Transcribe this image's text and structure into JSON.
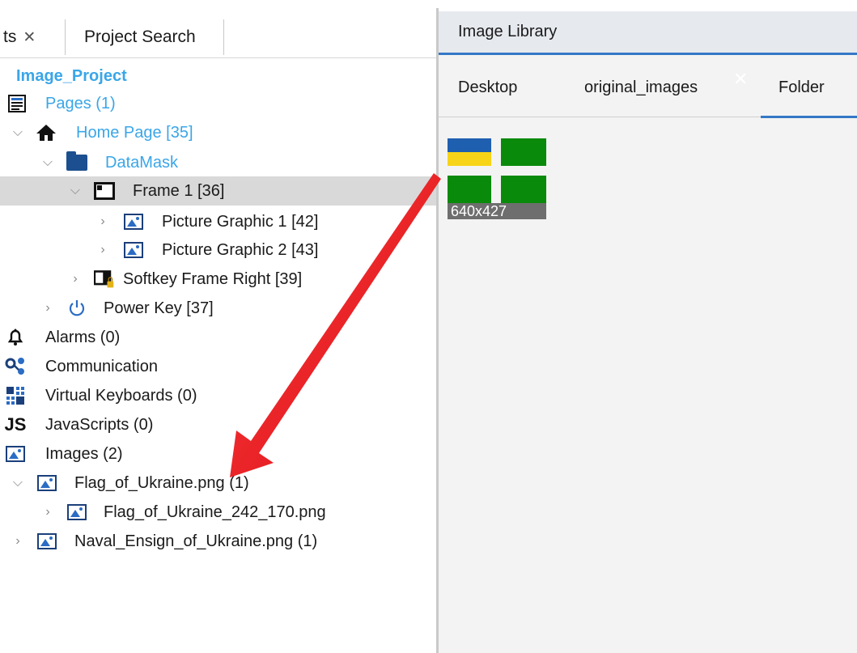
{
  "left_tabs": {
    "projects_label": "ts",
    "projects_close": "✕",
    "search_label": "Project Search"
  },
  "tree": {
    "project": "Image_Project",
    "pages": "Pages (1)",
    "home_page": "Home Page [35]",
    "datamask": "DataMask",
    "frame1": "Frame 1 [36]",
    "picture1": "Picture Graphic 1 [42]",
    "picture2": "Picture Graphic 2 [43]",
    "softkey": "Softkey Frame Right [39]",
    "power_key": "Power Key [37]",
    "alarms": "Alarms (0)",
    "communication": "Communication",
    "virtual_keyboards": "Virtual Keyboards (0)",
    "javascripts": "JavaScripts (0)",
    "images": "Images (2)",
    "flag_ukraine": "Flag_of_Ukraine.png (1)",
    "flag_ukraine_242": "Flag_of_Ukraine_242_170.png",
    "naval_ensign": "Naval_Ensign_of_Ukraine.png (1)"
  },
  "library": {
    "title": "Image Library",
    "tabs": [
      "Desktop",
      "original_images",
      "Folder"
    ],
    "close": "✕",
    "thumbnail_caption": "640x427"
  },
  "colors": {
    "accent": "#3478c6",
    "tree_link": "#3aa6e8",
    "arrow": "#e8141b",
    "flag_blue": "#1f5fb0",
    "flag_yellow": "#f7d417",
    "ensign_green": "#0a8a0a"
  }
}
